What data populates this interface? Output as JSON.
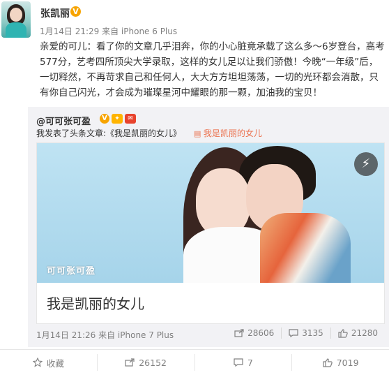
{
  "post": {
    "author": "张凯丽",
    "verified_badge": "V",
    "meta": "1月14日 21:29 来自 iPhone 6 Plus",
    "content": "亲爱的可儿：看了你的文章几乎泪奔，你的小心脏竟承载了这么多～6岁登台，高考577分，艺考四所顶尖大学录取，这样的女儿足以让我们骄傲！今晚“一年级”后，一切释然，不再苛求自己和任何人，大大方方坦坦荡荡，一切的光环都会消散，只有你自己闪光，才会成为璀璨星河中耀眼的那一颗，加油我的宝贝！"
  },
  "repost": {
    "author": "@可可张可盈",
    "badges": [
      "V",
      "",
      ""
    ],
    "line_prefix": "我发表了头条文章:《我是凯丽的女儿》",
    "link_text": "我是凯丽的女儿",
    "card": {
      "watermark": "可可张可盈",
      "title": "我是凯丽的女儿"
    },
    "meta": "1月14日 21:26 来自 iPhone 7 Plus",
    "stats": {
      "repost": "28606",
      "comment": "3135",
      "like": "21280"
    }
  },
  "actions": {
    "collect": "收藏",
    "share": "26152",
    "comment": "7",
    "like": "7019"
  },
  "colors": {
    "link": "#eb7350",
    "badge": "#f7a400",
    "meta": "#808080"
  }
}
